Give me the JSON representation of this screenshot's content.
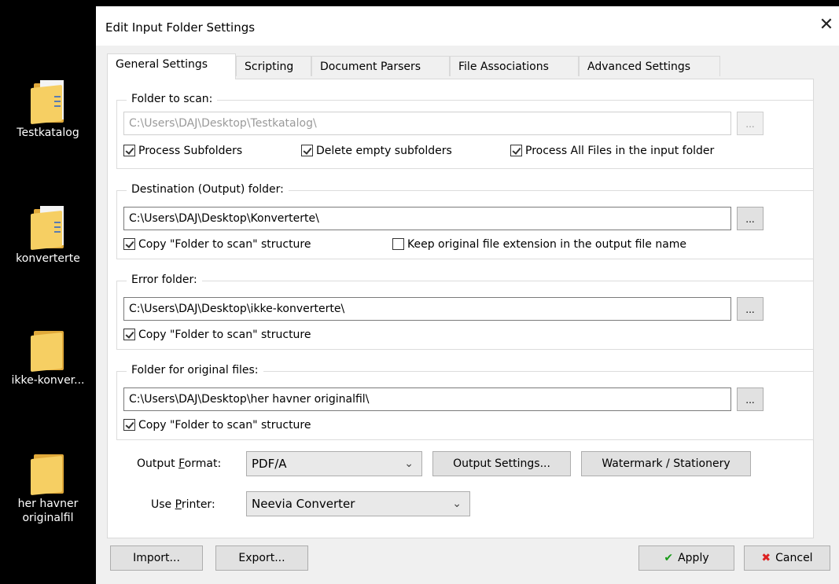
{
  "desktop": {
    "icons": [
      {
        "label": "Testkatalog"
      },
      {
        "label": "konverterte"
      },
      {
        "label": "ikke-konver..."
      },
      {
        "label": "her havner originalfil"
      }
    ]
  },
  "dialog": {
    "title": "Edit Input Folder Settings",
    "close": "✕",
    "tabs": [
      "General Settings",
      "Scripting",
      "Document Parsers",
      "File Associations",
      "Advanced Settings"
    ],
    "active_tab": "General Settings",
    "groups": {
      "scan": {
        "title": "Folder to scan:",
        "path": "C:\\Users\\DAJ\\Desktop\\Testkatalog\\",
        "browse": "...",
        "checks": [
          {
            "label": "Process Subfolders",
            "checked": true
          },
          {
            "label": "Delete empty subfolders",
            "checked": true
          },
          {
            "label": "Process All Files in the input folder",
            "checked": true
          }
        ]
      },
      "destination": {
        "title": "Destination (Output) folder:",
        "path": "C:\\Users\\DAJ\\Desktop\\Konverterte\\",
        "browse": "...",
        "checks": [
          {
            "label": "Copy \"Folder to scan\" structure",
            "checked": true
          },
          {
            "label": "Keep original file extension in the output file name",
            "checked": false
          }
        ]
      },
      "error": {
        "title": "Error folder:",
        "path": "C:\\Users\\DAJ\\Desktop\\ikke-konverterte\\",
        "browse": "...",
        "checks": [
          {
            "label": "Copy \"Folder to scan\" structure",
            "checked": true
          }
        ]
      },
      "original": {
        "title": "Folder for original files:",
        "path": "C:\\Users\\DAJ\\Desktop\\her havner originalfil\\",
        "browse": "...",
        "checks": [
          {
            "label": "Copy \"Folder to scan\" structure",
            "checked": true
          }
        ]
      }
    },
    "output_format": {
      "label_pre": "Output ",
      "label_accel": "F",
      "label_post": "ormat:",
      "value": "PDF/A"
    },
    "use_printer": {
      "label_pre": "Use ",
      "label_accel": "P",
      "label_post": "rinter:",
      "value": "Neevia Converter"
    },
    "buttons": {
      "output_settings": "Output Settings...",
      "watermark": "Watermark / Stationery",
      "import": "Import...",
      "export": "Export...",
      "apply": "Apply",
      "cancel": "Cancel"
    },
    "colors": {
      "apply_icon": "#1a9c1a",
      "cancel_icon": "#dd2222"
    }
  }
}
